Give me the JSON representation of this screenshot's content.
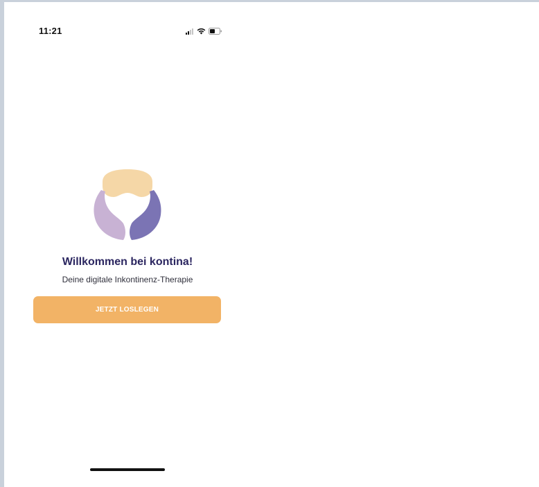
{
  "status_bar": {
    "time": "11:21",
    "icons": [
      "cellular-signal-icon",
      "wifi-icon",
      "battery-icon"
    ]
  },
  "logo": {
    "icon": "kontina-logo",
    "colors": {
      "top": "#f5d7a7",
      "left": "#c8b2d4",
      "right": "#7b74b4"
    }
  },
  "welcome": {
    "title": "Willkommen bei kontina!",
    "subtitle": "Deine digitale Inkontinenz-Therapie"
  },
  "start_button": {
    "label": "JETZT LOSLEGEN",
    "color": "#f2b366"
  },
  "colors": {
    "title_text": "#2b2660",
    "background": "#ffffff"
  }
}
